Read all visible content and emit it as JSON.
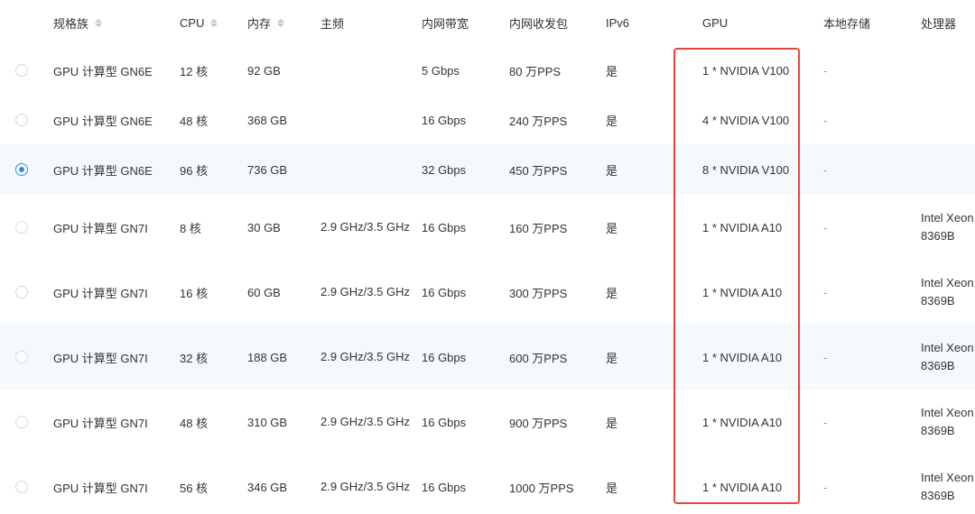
{
  "columns": [
    {
      "key": "family",
      "label": "规格族",
      "sortable": true
    },
    {
      "key": "cpu",
      "label": "CPU",
      "sortable": true
    },
    {
      "key": "memory",
      "label": "内存",
      "sortable": true
    },
    {
      "key": "freq",
      "label": "主频",
      "sortable": false
    },
    {
      "key": "bandwidth",
      "label": "内网带宽",
      "sortable": false
    },
    {
      "key": "pps",
      "label": "内网收发包",
      "sortable": false
    },
    {
      "key": "ipv6",
      "label": "IPv6",
      "sortable": false
    },
    {
      "key": "gpu",
      "label": "GPU",
      "sortable": false
    },
    {
      "key": "storage",
      "label": "本地存储",
      "sortable": false
    },
    {
      "key": "processor",
      "label": "处理器",
      "sortable": false
    }
  ],
  "rows": [
    {
      "selected": false,
      "family": "GPU 计算型 GN6E",
      "cpu": "12 核",
      "memory": "92 GB",
      "freq": "",
      "bandwidth": "5 Gbps",
      "pps": "80 万PPS",
      "ipv6": "是",
      "gpu": "1 * NVIDIA V100",
      "storage": "-",
      "processor": ""
    },
    {
      "selected": false,
      "family": "GPU 计算型 GN6E",
      "cpu": "48 核",
      "memory": "368 GB",
      "freq": "",
      "bandwidth": "16 Gbps",
      "pps": "240 万PPS",
      "ipv6": "是",
      "gpu": "4 * NVIDIA V100",
      "storage": "-",
      "processor": ""
    },
    {
      "selected": true,
      "family": "GPU 计算型 GN6E",
      "cpu": "96 核",
      "memory": "736 GB",
      "freq": "",
      "bandwidth": "32 Gbps",
      "pps": "450 万PPS",
      "ipv6": "是",
      "gpu": "8 * NVIDIA V100",
      "storage": "-",
      "processor": ""
    },
    {
      "selected": false,
      "family": "GPU 计算型 GN7I",
      "cpu": "8 核",
      "memory": "30 GB",
      "freq": "2.9 GHz/3.5 GHz",
      "bandwidth": "16 Gbps",
      "pps": "160 万PPS",
      "ipv6": "是",
      "gpu": "1 * NVIDIA A10",
      "storage": "-",
      "processor": "Intel Xeon 8369B"
    },
    {
      "selected": false,
      "family": "GPU 计算型 GN7I",
      "cpu": "16 核",
      "memory": "60 GB",
      "freq": "2.9 GHz/3.5 GHz",
      "bandwidth": "16 Gbps",
      "pps": "300 万PPS",
      "ipv6": "是",
      "gpu": "1 * NVIDIA A10",
      "storage": "-",
      "processor": "Intel Xeon 8369B"
    },
    {
      "selected": false,
      "family": "GPU 计算型 GN7I",
      "cpu": "32 核",
      "memory": "188 GB",
      "freq": "2.9 GHz/3.5 GHz",
      "bandwidth": "16 Gbps",
      "pps": "600 万PPS",
      "ipv6": "是",
      "gpu": "1 * NVIDIA A10",
      "storage": "-",
      "processor": "Intel Xeon 8369B"
    },
    {
      "selected": false,
      "family": "GPU 计算型 GN7I",
      "cpu": "48 核",
      "memory": "310 GB",
      "freq": "2.9 GHz/3.5 GHz",
      "bandwidth": "16 Gbps",
      "pps": "900 万PPS",
      "ipv6": "是",
      "gpu": "1 * NVIDIA A10",
      "storage": "-",
      "processor": "Intel Xeon 8369B"
    },
    {
      "selected": false,
      "family": "GPU 计算型 GN7I",
      "cpu": "56 核",
      "memory": "346 GB",
      "freq": "2.9 GHz/3.5 GHz",
      "bandwidth": "16 Gbps",
      "pps": "1000 万PPS",
      "ipv6": "是",
      "gpu": "1 * NVIDIA A10",
      "storage": "-",
      "processor": "Intel Xeon 8369B"
    }
  ],
  "colors": {
    "alt_row_bg": "#f4f9fd",
    "radio_checked": "#2d8cf0",
    "highlight_border": "#e8453c"
  }
}
